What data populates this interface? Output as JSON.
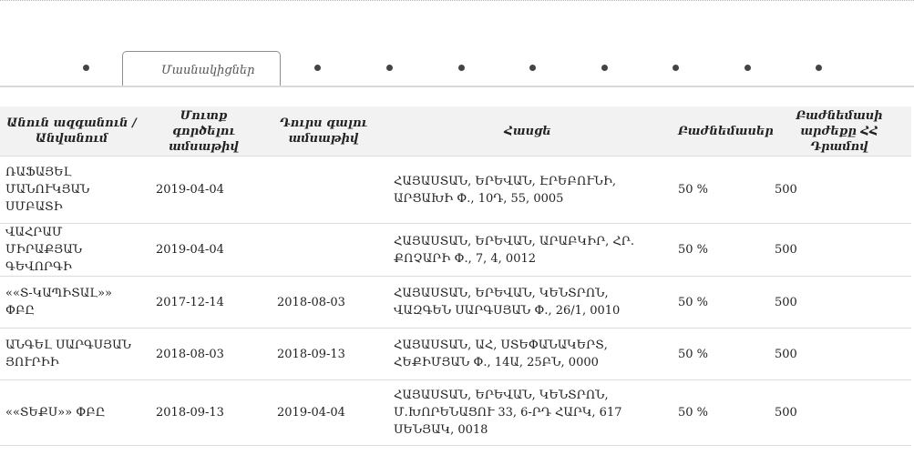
{
  "tabs": {
    "active_label": "Մասնակիցներ"
  },
  "table": {
    "headers": {
      "name": "Անուն ազգանուն / Անվանում",
      "entry_date": "Մուտք գործելու ամսաթիվ",
      "exit_date": "Դուրս գալու ամսաթիվ",
      "address": "Հասցե",
      "share": "Բաժնեմասեր",
      "value": "Բաժնեմասի արժեքը ՀՀ Դրամով"
    },
    "rows": [
      {
        "name": "ՌԱՖԱՅԵԼ ՄԱՆՈՒԿՅԱՆ ՍՄԲԱՏԻ",
        "entry_date": "2019-04-04",
        "exit_date": "",
        "address": "ՀԱՅԱՍՏԱՆ, ԵՐԵՎԱՆ, ԷՐԵԲՈՒՆԻ, ԱՐՑԱԽԻ Փ., 10Դ, 55, 0005",
        "share": "50 %",
        "value": "500"
      },
      {
        "name": "ՎԱՀՐԱՄ ՄԻՐԱՔՅԱՆ ԳԵՎՈՐԳԻ",
        "entry_date": "2019-04-04",
        "exit_date": "",
        "address": "ՀԱՅԱՍՏԱՆ, ԵՐԵՎԱՆ, ԱՐԱԲԿԻՐ, ՀՐ. ՔՈՉԱՐԻ Փ., 7, 4, 0012",
        "share": "50 %",
        "value": "500"
      },
      {
        "name": "««Տ-ԿԱՊԻՏԱԼ»» ՓԲԸ",
        "entry_date": "2017-12-14",
        "exit_date": "2018-08-03",
        "address": "ՀԱՅԱՍՏԱՆ, ԵՐԵՎԱՆ, ԿԵՆՏՐՈՆ, ՎԱԶԳԵՆ ՍԱՐԳՍՅԱՆ Փ., 26/1, 0010",
        "share": "50 %",
        "value": "500"
      },
      {
        "name": "ԱՆԳԵԼ ՍԱՐԳՍՅԱՆ ՅՈՒՐԻԻ",
        "entry_date": "2018-08-03",
        "exit_date": "2018-09-13",
        "address": "ՀԱՅԱՍՏԱՆ, ԱՀ, ՍՏԵՓԱՆԱԿԵՐՏ, ՀԵՔԻՄՅԱՆ Փ., 14Ա, 25ԲՆ, 0000",
        "share": "50 %",
        "value": "500"
      },
      {
        "name": "««ՏԵՔՍ»» ՓԲԸ",
        "entry_date": "2018-09-13",
        "exit_date": "2019-04-04",
        "address": "ՀԱՅԱՍՏԱՆ, ԵՐԵՎԱՆ, ԿԵՆՏՐՈՆ, Մ.ԽՈՐԵՆԱՑՈՒ 33, 6-ՐԴ ՀԱՐԿ, 617 ՍԵՆՅԱԿ, 0018",
        "share": "50 %",
        "value": "500"
      }
    ]
  }
}
